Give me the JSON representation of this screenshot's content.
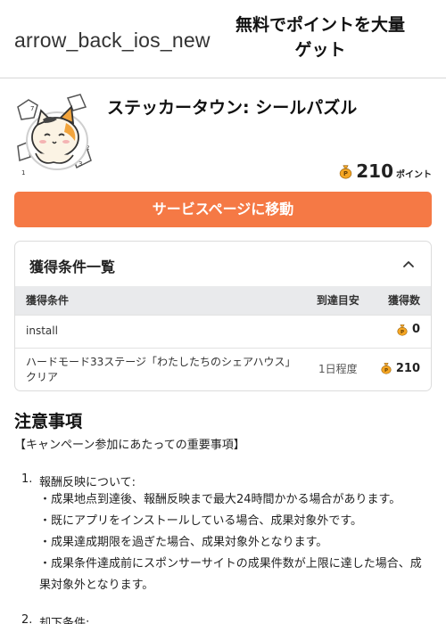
{
  "header": {
    "back_label": "arrow_back_ios_new",
    "title": "無料でポイントを大量ゲット"
  },
  "app": {
    "name": "ステッカータウン: シールパズル",
    "icon": "sticker-cat-app-icon",
    "points": "210",
    "points_unit": "ポイント",
    "coin_color": "#f5a623"
  },
  "service_button": {
    "label": "サービスページに移動",
    "color": "#f57945"
  },
  "conditions": {
    "title": "獲得条件一覧",
    "columns": [
      "獲得条件",
      "到達目安",
      "獲得数"
    ],
    "rows": [
      {
        "condition": "install",
        "eta": "",
        "points": "0"
      },
      {
        "condition": "ハードモード33ステージ「わたしたちのシェアハウス」クリア",
        "eta": "1日程度",
        "points": "210"
      }
    ]
  },
  "notes": {
    "title": "注意事項",
    "subtitle": "【キャンペーン参加にあたっての重要事項】",
    "items": [
      {
        "num": "1.",
        "label": "報酬反映について:",
        "bullets": [
          "・成果地点到達後、報酬反映まで最大24時間かかる場合があります。",
          "・既にアプリをインストールしている場合、成果対象外です。",
          "・成果達成期限を過ぎた場合、成果対象外となります。",
          "・成果条件達成前にスポンサーサイトの成果件数が上限に達した場合、成果対象外となります。"
        ]
      },
      {
        "num": "2.",
        "label": "却下条件:"
      }
    ]
  }
}
